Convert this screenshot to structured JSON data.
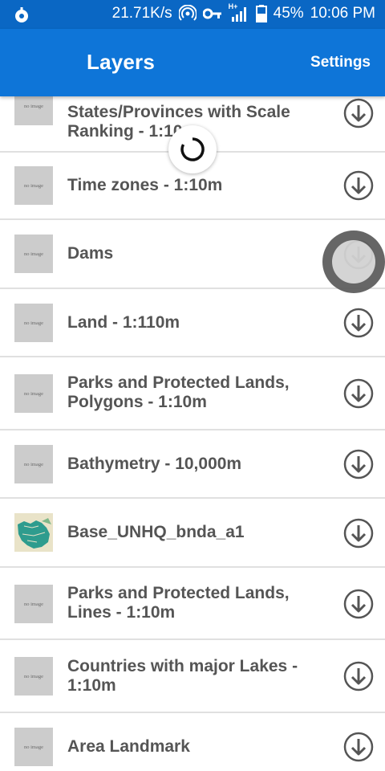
{
  "status_bar": {
    "network_speed": "21.71K/s",
    "network_type": "H+",
    "battery": "45%",
    "time": "10:06 PM"
  },
  "app_bar": {
    "title": "Layers",
    "settings_label": "Settings"
  },
  "layers": [
    {
      "name": "States/Provinces with Scale Ranking - 1:10m",
      "thumbnail": "no image"
    },
    {
      "name": "Time zones - 1:10m",
      "thumbnail": "no image"
    },
    {
      "name": "Dams",
      "thumbnail": "no image"
    },
    {
      "name": "Land - 1:110m",
      "thumbnail": "no image"
    },
    {
      "name": "Parks and Protected Lands, Polygons - 1:10m",
      "thumbnail": "no image"
    },
    {
      "name": "Bathymetry - 10,000m",
      "thumbnail": "no image"
    },
    {
      "name": "Base_UNHQ_bnda_a1",
      "thumbnail": "map-preview"
    },
    {
      "name": "Parks and Protected Lands, Lines - 1:10m",
      "thumbnail": "no image"
    },
    {
      "name": "Countries with major Lakes - 1:10m",
      "thumbnail": "no image"
    },
    {
      "name": "Area Landmark",
      "thumbnail": "no image"
    }
  ],
  "icons": {
    "download": "download-circle-icon",
    "spinner": "loading-spinner"
  },
  "colors": {
    "status_bar": "#0a67c4",
    "app_bar": "#0e75d8",
    "text": "#555555",
    "thumbnail_placeholder": "#cccccc"
  }
}
